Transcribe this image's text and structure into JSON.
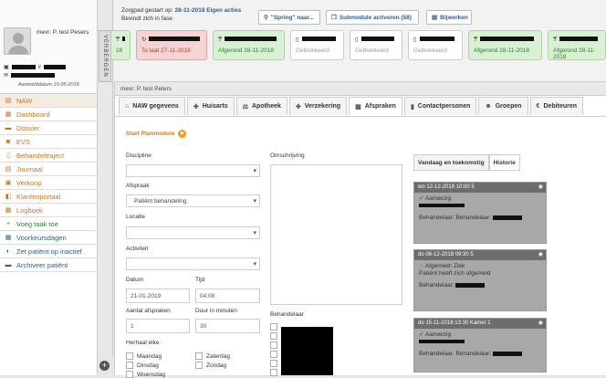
{
  "patient": {
    "name": "mevr. P. test Pesers",
    "registration": "Aanmelddatum 15-05-2018"
  },
  "verbergen_label": "VERBERGEN",
  "nav": [
    {
      "label": "NAW",
      "icon": "id-card-icon",
      "glyph": "▤",
      "style": "active"
    },
    {
      "label": "Dashboard",
      "icon": "dashboard-icon",
      "glyph": "▦",
      "style": ""
    },
    {
      "label": "Dossier",
      "icon": "folder-icon",
      "glyph": "▬",
      "style": ""
    },
    {
      "label": "EVS",
      "icon": "camera-icon",
      "glyph": "◙",
      "style": ""
    },
    {
      "label": "Behandeltraject",
      "icon": "document-icon",
      "glyph": "▯",
      "style": ""
    },
    {
      "label": "Journaal",
      "icon": "journal-icon",
      "glyph": "▤",
      "style": ""
    },
    {
      "label": "Verkoop",
      "icon": "cart-icon",
      "glyph": "▣",
      "style": ""
    },
    {
      "label": "Klantenportaal",
      "icon": "portal-icon",
      "glyph": "◧",
      "style": ""
    },
    {
      "label": "Logboek",
      "icon": "log-icon",
      "glyph": "▦",
      "style": ""
    },
    {
      "label": "Voeg taak toe",
      "icon": "plus-icon",
      "glyph": "+",
      "style": "green"
    },
    {
      "label": "Voorkeursdagen",
      "icon": "calendar-icon",
      "glyph": "▦",
      "style": "blue"
    },
    {
      "label": "Zet patiënt op inactief",
      "icon": "user-inactive-icon",
      "glyph": "◐",
      "style": "blue"
    },
    {
      "label": "Archiveer patiënt",
      "icon": "archive-icon",
      "glyph": "▬",
      "style": "blue"
    }
  ],
  "topbar": {
    "zorgpad_prefix": "Zorgpad gestart op:",
    "zorgpad_date": "28-11-2018",
    "zorgpad_action": "Eigen acties",
    "phase": "Bevindt zich in fase",
    "btn_spring": "\"Spring\" naar...",
    "btn_submodule": "Submodule activeren (58)",
    "btn_bijwerken": "Bijwerken"
  },
  "cards": [
    {
      "color": "green",
      "line2": "18",
      "prefix": ""
    },
    {
      "color": "red",
      "line2": "Te laat 27-11-2018",
      "prefix": ""
    },
    {
      "color": "green",
      "line2": "Afgerond 28-11-2018",
      "prefix": ""
    },
    {
      "color": "gray",
      "line2": "Geblokkeerd",
      "prefix": ""
    },
    {
      "color": "gray",
      "line2": "Geblokkeerd",
      "prefix": ""
    },
    {
      "color": "gray",
      "line2": "Geblokkeerd",
      "prefix": ""
    },
    {
      "color": "green",
      "line2": "Afgerond 28-11-2018",
      "prefix": ""
    },
    {
      "color": "green",
      "line2": "Afgerond 28-11-2018",
      "prefix": ""
    }
  ],
  "main_title": "mevr. P. test Peters",
  "tabs": [
    {
      "label": "NAW gegevens",
      "icon": "home-icon",
      "glyph": "⌂",
      "active": false
    },
    {
      "label": "Huisarts",
      "icon": "stethoscope-icon",
      "glyph": "✚",
      "active": false
    },
    {
      "label": "Apotheek",
      "icon": "scale-icon",
      "glyph": "⚖",
      "active": false
    },
    {
      "label": "Verzekering",
      "icon": "insurance-icon",
      "glyph": "✚",
      "active": false
    },
    {
      "label": "Afspraken",
      "icon": "calendar-icon",
      "glyph": "▦",
      "active": true
    },
    {
      "label": "Contactpersonen",
      "icon": "contact-icon",
      "glyph": "▮",
      "active": false
    },
    {
      "label": "Groepen",
      "icon": "group-icon",
      "glyph": "☻",
      "active": false
    },
    {
      "label": "Debiteuren",
      "icon": "euro-icon",
      "glyph": "€",
      "active": false
    }
  ],
  "form": {
    "start_plan": "Start Planmodule",
    "discipline_label": "Discipline",
    "afspraak_label": "Afspraak",
    "afspraak_value": "Patiënt behandeling",
    "locatie_label": "Locatie",
    "activiteit_label": "Activiteit",
    "datum_label": "Datum",
    "datum_value": "21-01-2019",
    "tijd_label": "Tijd",
    "tijd_value": "04:08",
    "aantal_label": "Aantal afspraken",
    "aantal_value": "1",
    "duur_label": "Duur in minuten",
    "duur_value": "30",
    "herhaal_label": "Herhaal elke :",
    "days": [
      "Maandag",
      "Dinsdag",
      "Woensdag",
      "Zaterdag",
      "Zondag"
    ],
    "omschrijving_label": "Omschrijving",
    "behandelaar_label": "Behandelaar"
  },
  "right_tabs": [
    {
      "label": "Vandaag en toekomstig",
      "active": false
    },
    {
      "label": "Historie",
      "active": true
    }
  ],
  "appointments": [
    {
      "header": "wo 12-12-2018 10:00 5",
      "status": "Aanwezig",
      "status_type": "ok",
      "note": "",
      "behandelaar": "Behandelaar: Behandelaar:"
    },
    {
      "header": "do 06-12-2018 09:30 5",
      "status": "Afgemeld: Ziek",
      "status_type": "cancel",
      "note": "Patiënt heeft zich afgemeld",
      "behandelaar": "Behandelaar:"
    },
    {
      "header": "do 15-11-2018 13:30 Kamer 1",
      "status": "Aanwezig",
      "status_type": "ok",
      "note": "",
      "behandelaar": "Behandelaar: Behandelaar:"
    }
  ]
}
